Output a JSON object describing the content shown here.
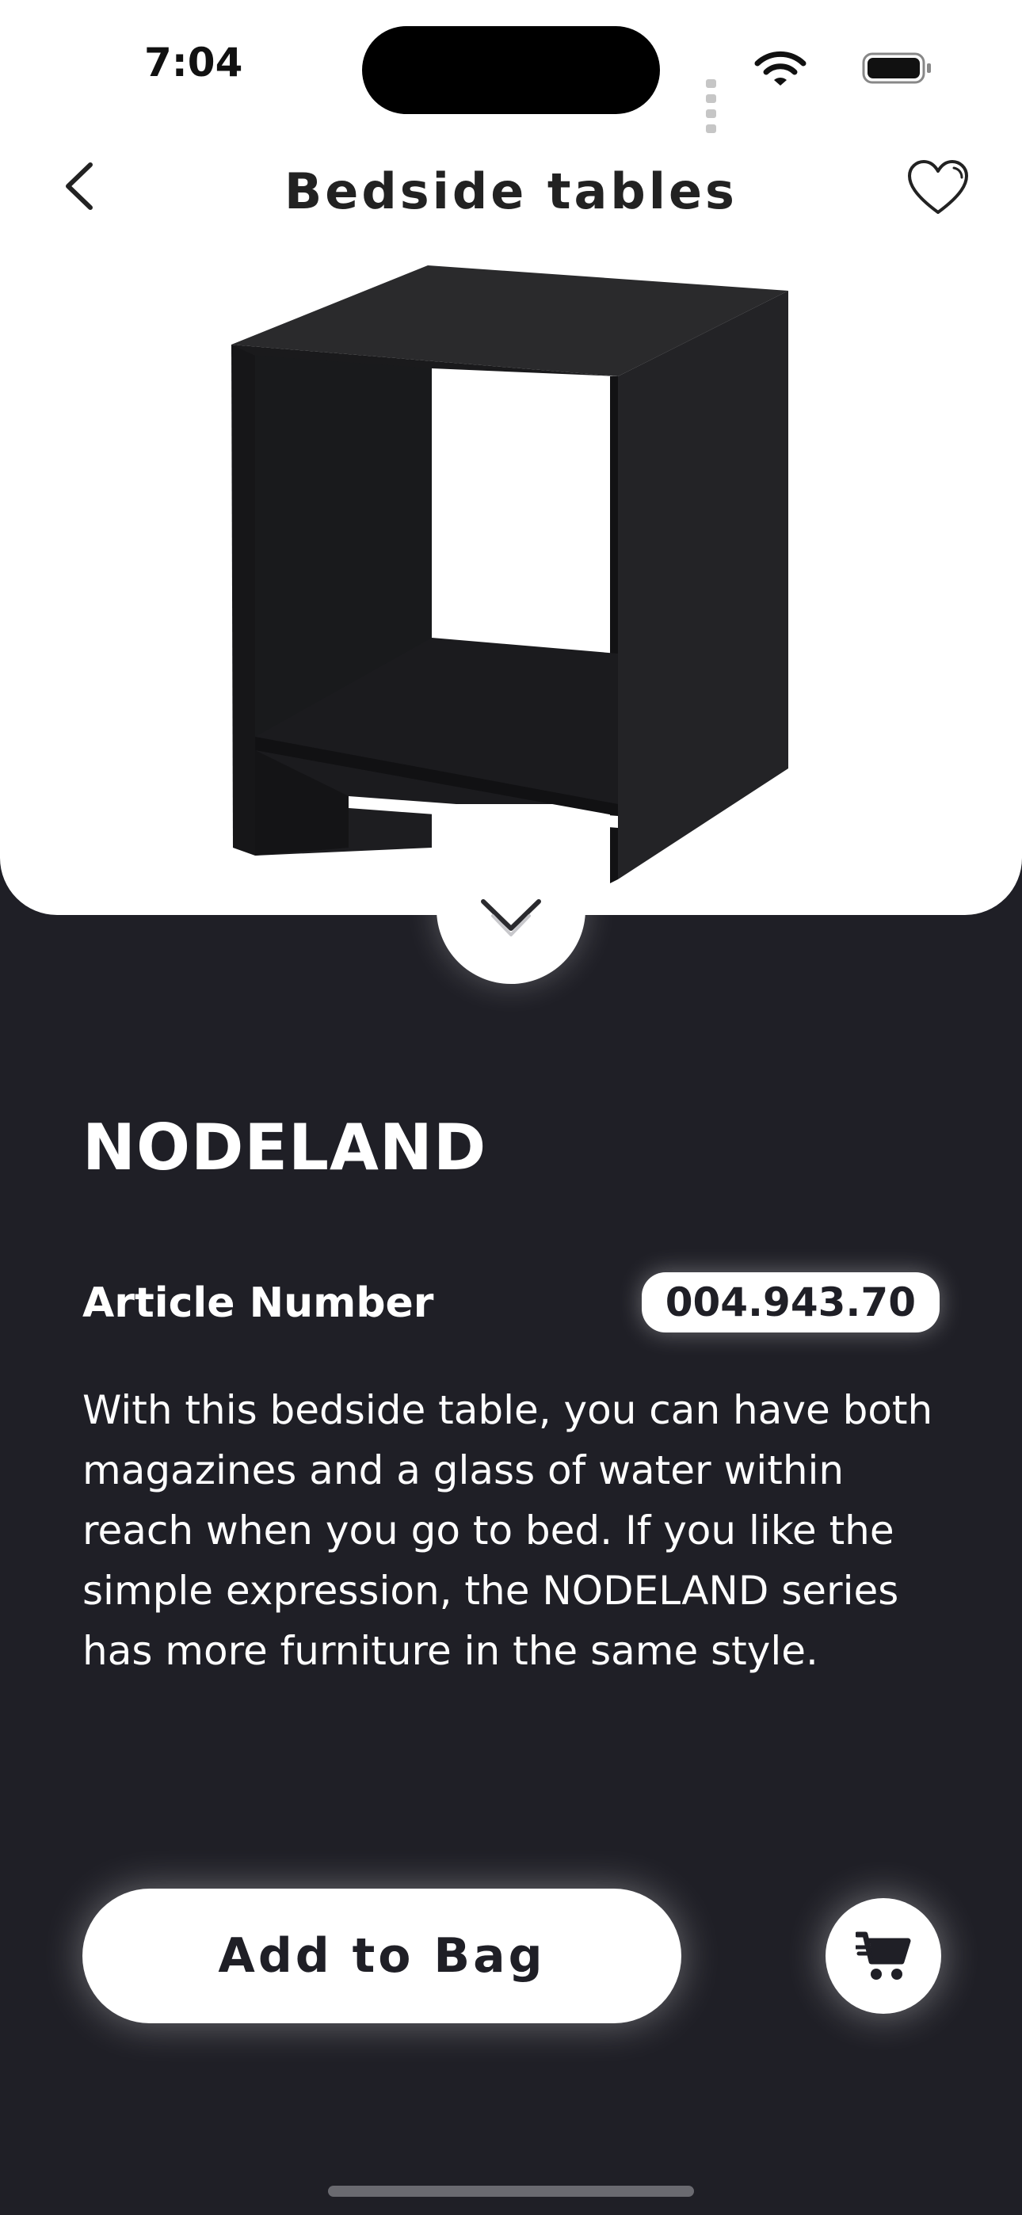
{
  "status_bar": {
    "time": "7:04"
  },
  "nav": {
    "title": "Bedside tables"
  },
  "product": {
    "name": "NODELAND",
    "article_label": "Article Number",
    "article_number": "004.943.70",
    "description": "With this bedside table, you can have both magazines and a glass of water within reach when you go to bed. If you like the simple expression, the NODELAND series has more furniture in the same style."
  },
  "actions": {
    "add_to_bag_label": "Add to Bag"
  },
  "icons": {
    "back": "chevron-left-icon",
    "favorite": "heart-icon",
    "collapse": "chevron-down-icon",
    "cart": "shopping-cart-icon"
  },
  "colors": {
    "background": "#1f1f26",
    "card": "#ffffff",
    "text_light": "#ffffff"
  }
}
